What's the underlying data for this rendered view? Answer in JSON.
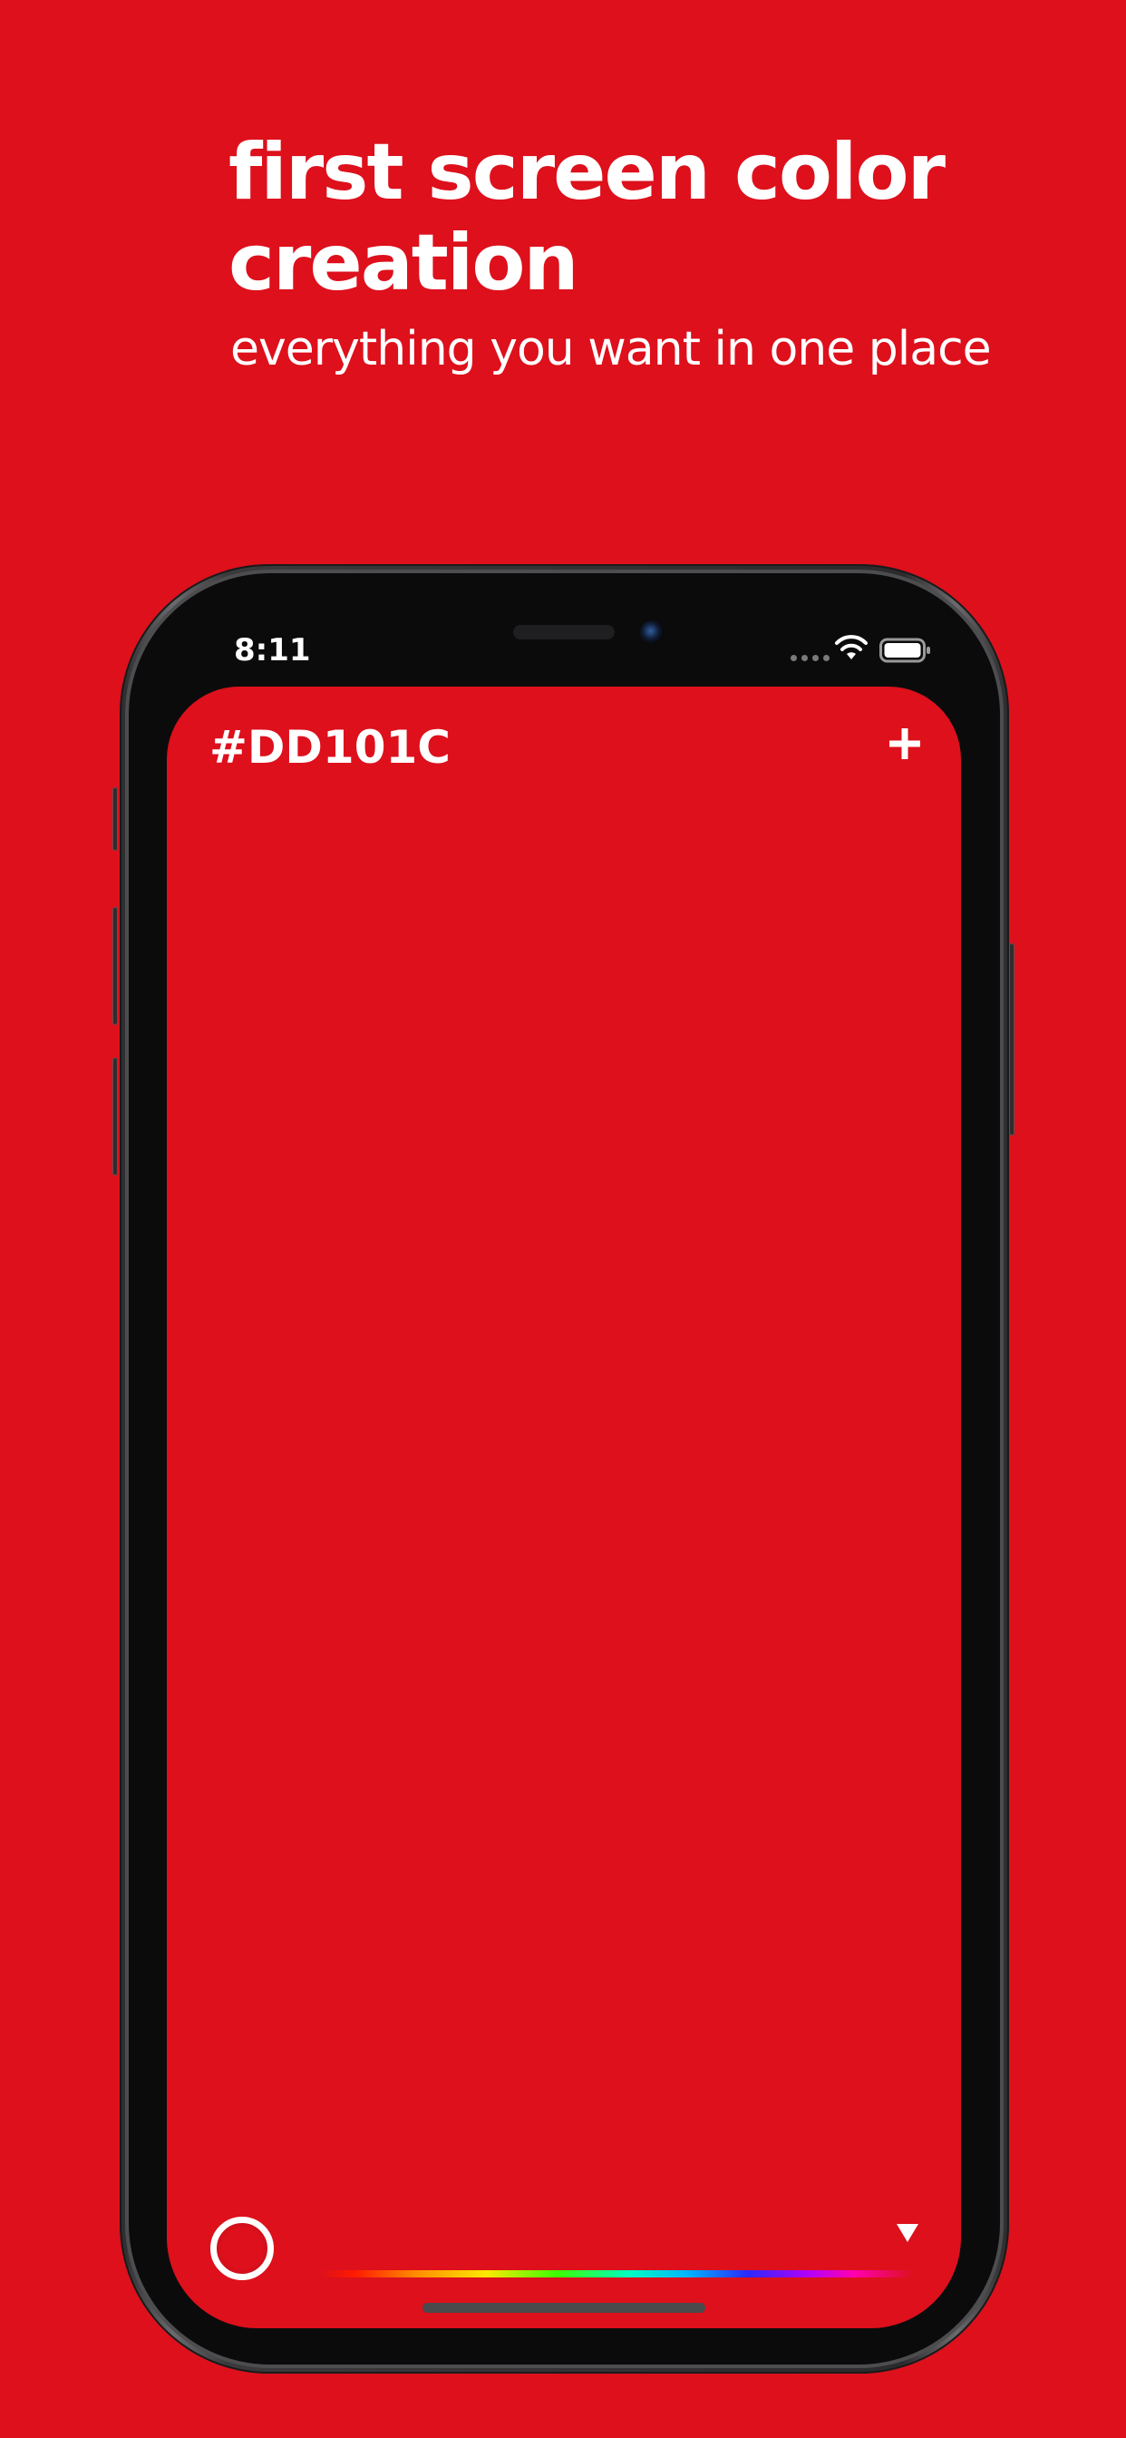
{
  "marketing": {
    "headline": "first screen color creation",
    "subheadline": "everything you want in one place"
  },
  "status_bar": {
    "time": "8:11"
  },
  "screen": {
    "hex_value": "#DD101C",
    "background_color": "#DD101C",
    "add_icon": "plus-icon",
    "collapse_icon": "triangle-down-icon"
  },
  "colors": {
    "page_background": "#DD101C",
    "text": "#FFFFFF"
  }
}
